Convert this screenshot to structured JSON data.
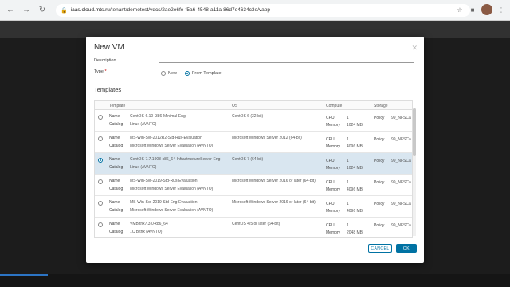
{
  "browser": {
    "url_host": "iaas.cloud.mts.ru",
    "url_path": "/tenant/demotest/vdcs/2ae2e6fe-f5a6-4548-a11a-86d7e4634c3e/vapp"
  },
  "dialog": {
    "title": "New VM",
    "description_label": "Description",
    "type_label": "Type",
    "required_mark": "*",
    "type_options": [
      "New",
      "From Template"
    ],
    "templates_title": "Templates",
    "columns": [
      "Template",
      "OS",
      "Compute",
      "Storage"
    ],
    "rows": [
      {
        "name_key": "Name",
        "name": "CentOS-6.10-i386-Minimal-Eng",
        "catalog_key": "Catalog",
        "catalog": "Linux (AVNTO)",
        "os": "CentOS 6 (32-bit)",
        "cpu_key": "CPU",
        "cpu": "1",
        "mem_key": "Memory",
        "memory": "1024 MB",
        "policy_key": "Policy",
        "policy": "99_NFSCa",
        "selected": false
      },
      {
        "name_key": "Name",
        "name": "MS-Win-Svr-2012R2-Std-Rus-Evaluation",
        "catalog_key": "Catalog",
        "catalog": "Microsoft Windows Server Evaluation (AVNTO)",
        "os": "Microsoft Windows Server 2012 (64-bit)",
        "cpu_key": "CPU",
        "cpu": "1",
        "mem_key": "Memory",
        "memory": "4096 MB",
        "policy_key": "Policy",
        "policy": "99_NFSCa",
        "selected": false
      },
      {
        "name_key": "Name",
        "name": "CentOS-7.7.1908-x86_64-InfrastructureServer-Eng",
        "catalog_key": "Catalog",
        "catalog": "Linux (AVNTO)",
        "os": "CentOS 7 (64-bit)",
        "cpu_key": "CPU",
        "cpu": "1",
        "mem_key": "Memory",
        "memory": "1024 MB",
        "policy_key": "Policy",
        "policy": "99_NFSCa",
        "selected": true
      },
      {
        "name_key": "Name",
        "name": "MS-Win-Svr-2019-Std-Rus-Evaluation",
        "catalog_key": "Catalog",
        "catalog": "Microsoft Windows Server Evaluation (AVNTO)",
        "os": "Microsoft Windows Server 2016 or later (64-bit)",
        "cpu_key": "CPU",
        "cpu": "1",
        "mem_key": "Memory",
        "memory": "4096 MB",
        "policy_key": "Policy",
        "policy": "99_NFSCa",
        "selected": false
      },
      {
        "name_key": "Name",
        "name": "MS-Win-Svr-2019-Std-Eng-Evaluation",
        "catalog_key": "Catalog",
        "catalog": "Microsoft Windows Server Evaluation (AVNTO)",
        "os": "Microsoft Windows Server 2016 or later (64-bit)",
        "cpu_key": "CPU",
        "cpu": "1",
        "mem_key": "Memory",
        "memory": "4096 MB",
        "policy_key": "Policy",
        "policy": "99_NFSCa",
        "selected": false
      },
      {
        "name_key": "Name",
        "name": "VMBitrix7.3.0-x86_64",
        "catalog_key": "Catalog",
        "catalog": "1C Bitrix (AVNTO)",
        "os": "CentOS 4/5 or later (64-bit)",
        "cpu_key": "CPU",
        "cpu": "1",
        "mem_key": "Memory",
        "memory": "2048 MB",
        "policy_key": "Policy",
        "policy": "99_NFSCa",
        "selected": false
      }
    ],
    "cancel_label": "CANCEL",
    "ok_label": "OK"
  },
  "colors": {
    "accent": "#0072a3",
    "selected_row": "#d9e6f0"
  }
}
